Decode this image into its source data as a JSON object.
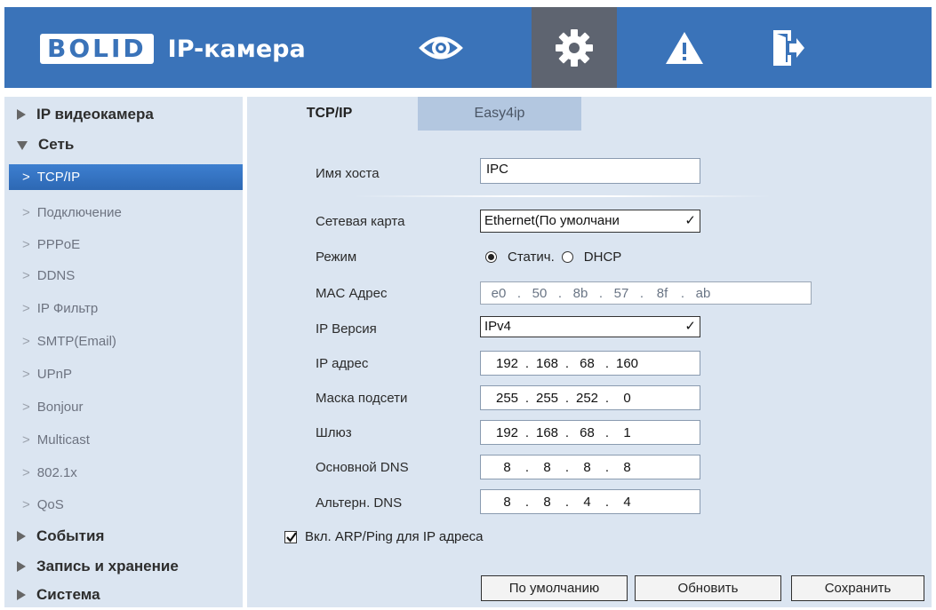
{
  "header": {
    "logo_text": "BOLID",
    "app_title": "IP-камера",
    "nav": [
      {
        "icon": "eye-icon"
      },
      {
        "icon": "gear-icon",
        "active": true
      },
      {
        "icon": "warning-icon"
      },
      {
        "icon": "logout-icon"
      }
    ]
  },
  "sidebar": {
    "items": [
      {
        "label": "IP видеокамера",
        "level": "top",
        "expanded": false
      },
      {
        "label": "Сеть",
        "level": "top",
        "expanded": true
      },
      {
        "label": "TCP/IP",
        "level": "sub",
        "active": true
      },
      {
        "label": "Подключение",
        "level": "sub"
      },
      {
        "label": "PPPoE",
        "level": "sub"
      },
      {
        "label": "DDNS",
        "level": "sub"
      },
      {
        "label": "IP Фильтр",
        "level": "sub"
      },
      {
        "label": "SMTP(Email)",
        "level": "sub"
      },
      {
        "label": "UPnP",
        "level": "sub"
      },
      {
        "label": "Bonjour",
        "level": "sub"
      },
      {
        "label": "Multicast",
        "level": "sub"
      },
      {
        "label": "802.1x",
        "level": "sub"
      },
      {
        "label": "QoS",
        "level": "sub"
      },
      {
        "label": "События",
        "level": "top",
        "expanded": false
      },
      {
        "label": "Запись и хранение",
        "level": "top",
        "expanded": false
      },
      {
        "label": "Система",
        "level": "top",
        "expanded": false
      }
    ]
  },
  "tabs": [
    {
      "label": "TCP/IP",
      "active": true
    },
    {
      "label": "Easy4ip",
      "active": false
    }
  ],
  "form": {
    "hostname": {
      "label": "Имя хоста",
      "value": "IPC"
    },
    "nic": {
      "label": "Сетевая карта",
      "value": "Ethernet(По умолчани"
    },
    "mode": {
      "label": "Режим",
      "static": "Статич.",
      "dhcp": "DHCP",
      "selected": "static"
    },
    "mac": {
      "label": "MAC Адрес",
      "octets": [
        "e0",
        "50",
        "8b",
        "57",
        "8f",
        "ab"
      ]
    },
    "ip_version": {
      "label": "IP Версия",
      "value": "IPv4"
    },
    "ip": {
      "label": "IP адрес",
      "octets": [
        "192",
        "168",
        "68",
        "160"
      ]
    },
    "mask": {
      "label": "Маска подсети",
      "octets": [
        "255",
        "255",
        "252",
        "0"
      ]
    },
    "gateway": {
      "label": "Шлюз",
      "octets": [
        "192",
        "168",
        "68",
        "1"
      ]
    },
    "dns1": {
      "label": "Основной DNS",
      "octets": [
        "8",
        "8",
        "8",
        "8"
      ]
    },
    "dns2": {
      "label": "Альтерн. DNS",
      "octets": [
        "8",
        "8",
        "4",
        "4"
      ]
    },
    "arp_ping": {
      "label": "Вкл. ARP/Ping для IP адреса",
      "checked": true
    }
  },
  "buttons": {
    "default": "По умолчанию",
    "refresh": "Обновить",
    "save": "Сохранить"
  },
  "colors": {
    "header_bg": "#3a73b9",
    "panel_bg": "#dbe5f1",
    "active_item": "#2d68b4",
    "active_nav": "#5e6470"
  }
}
